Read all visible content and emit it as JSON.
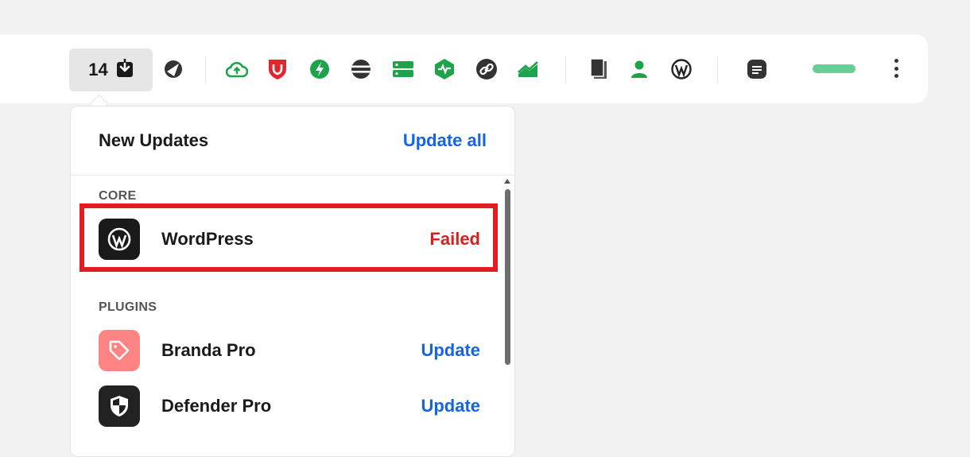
{
  "toolbar": {
    "updates_count": "14",
    "icons": [
      "cloud-upload-icon",
      "shield-badge-icon",
      "lightning-bolt-icon",
      "stack-layers-icon",
      "server-icon",
      "hexagon-pulse-icon",
      "link-icon",
      "trend-chart-icon",
      "documents-icon",
      "user-icon",
      "wordpress-icon",
      "menu-lines-icon"
    ],
    "colors": {
      "green": "#1fa34a",
      "red": "#e1262d",
      "dark": "#333333",
      "pill": "#68cf95"
    }
  },
  "panel": {
    "title": "New Updates",
    "update_all": "Update all",
    "core": {
      "label": "CORE",
      "items": [
        {
          "name": "WordPress",
          "status": "Failed",
          "icon": "wordpress-icon",
          "icon_bg": "#1a1a1a"
        }
      ]
    },
    "plugins": {
      "label": "PLUGINS",
      "items": [
        {
          "name": "Branda Pro",
          "action": "Update",
          "icon": "tag-icon",
          "icon_bg": "#ff8585"
        },
        {
          "name": "Defender Pro",
          "action": "Update",
          "icon": "shield-icon",
          "icon_bg": "#222222"
        }
      ]
    },
    "colors": {
      "link": "#1464e6",
      "failed": "#d52121",
      "highlight": "#e31b23"
    }
  }
}
